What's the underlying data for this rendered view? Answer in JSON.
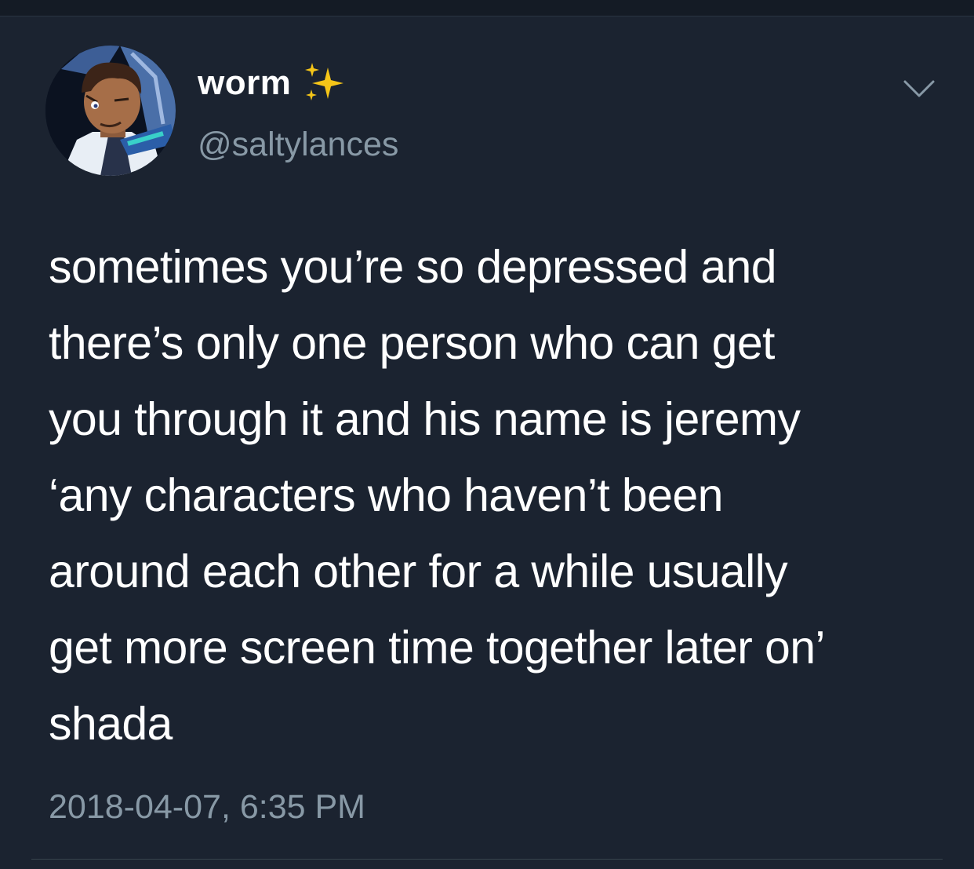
{
  "author": {
    "display_name": "worm",
    "handle": "@saltylances",
    "name_emoji_icon": "sparkles-icon",
    "avatar_icon": "avatar-image"
  },
  "tweet": {
    "text_lines": [
      "sometimes you’re so depressed and",
      "there’s only one person who can get",
      "you through it and his name is jeremy",
      "‘any characters who haven’t been",
      "around each other for a while usually",
      "get more screen time together later on’",
      "shada"
    ],
    "timestamp": "2018-04-07, 6:35 PM"
  },
  "menu": {
    "icon": "chevron-down-icon"
  },
  "colors": {
    "background": "#1b2330",
    "primary_text": "#ffffff",
    "secondary_text": "#8899a6",
    "sparkle": "#f5c518",
    "divider": "#38444d"
  }
}
